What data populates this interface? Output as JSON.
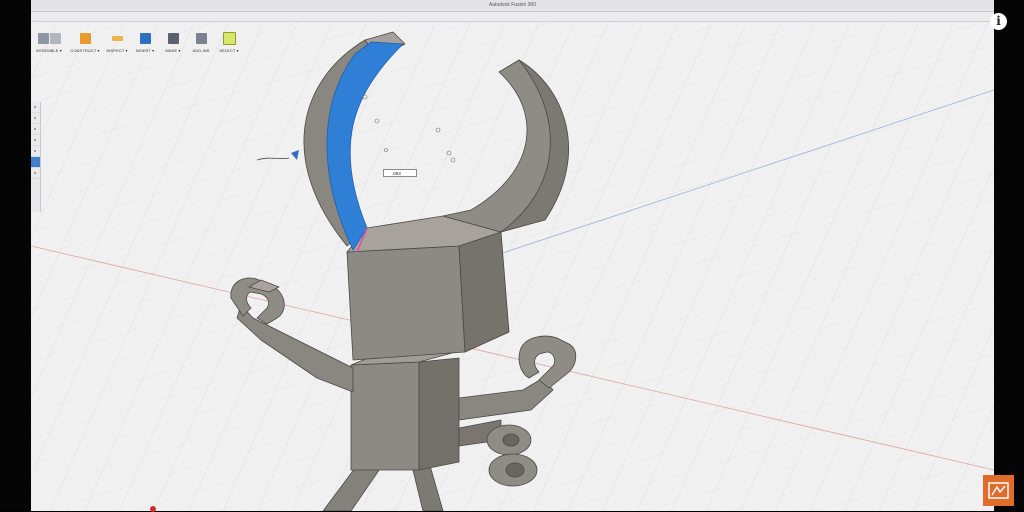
{
  "window": {
    "title": "Autodesk Fusion 360"
  },
  "toolbar": {
    "groups": [
      {
        "label": "ASSEMBLE ▾",
        "icon": "assemble-icon"
      },
      {
        "label": "CONSTRUCT ▾",
        "icon": "construct-icon"
      },
      {
        "label": "INSPECT ▾",
        "icon": "inspect-icon"
      },
      {
        "label": "INSERT ▾",
        "icon": "insert-icon"
      },
      {
        "label": "MAKE ▾",
        "icon": "make-icon"
      },
      {
        "label": "ADD-INS",
        "icon": "add-ins-icon"
      },
      {
        "label": "SELECT ▾",
        "icon": "select-icon"
      }
    ]
  },
  "dimension_input": {
    "value": ".093"
  },
  "overlay": {
    "info_icon": "i",
    "brand_icon": "channel-logo-icon"
  },
  "colors": {
    "model_gray": "#8b8780",
    "selected_face_blue": "#2f7fd6",
    "grid_background": "#f1f1f2",
    "badge_orange": "#e06b2b",
    "toolbar_accent_blue": "#2f6fbf",
    "toolbar_accent_orange": "#e59b2d"
  }
}
